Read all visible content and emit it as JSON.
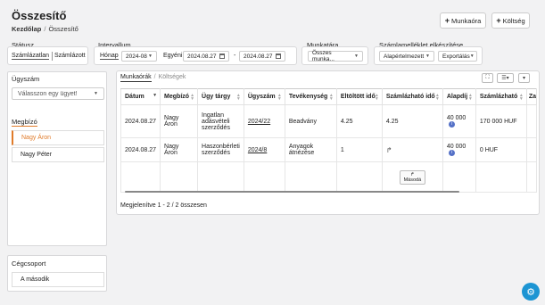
{
  "header": {
    "title": "Összesítő",
    "breadcrumb": {
      "home": "Kezdőlap",
      "separator": "/",
      "current": "Összesítő"
    },
    "add_work_hours": "Munkaóra",
    "add_cost": "Költség"
  },
  "filters": {
    "status": {
      "label": "Státusz",
      "options": [
        "Számlázatlan",
        "Számlázott"
      ],
      "active": "Számlázatlan"
    },
    "interval": {
      "label": "Intervallum",
      "mode_month": "Hónap",
      "month_value": "2024-08",
      "mode_custom": "Egyéni",
      "from": "2024.08.27",
      "dash": "-",
      "to": "2024.08.27"
    },
    "worklist": {
      "label": "Munkatára",
      "value": "Összes munka..."
    },
    "invoice_attachment": {
      "label": "Számlamelléklet elkészítése",
      "template": "Alapértelmezett",
      "export": "Exportálás"
    }
  },
  "sidebar": {
    "case_label": "Ügyszám",
    "case_placeholder": "Válasszon egy ügyet!",
    "client_label": "Megbízó",
    "clients": [
      "Nagy Áron",
      "Nagy Péter"
    ],
    "group_label": "Cégcsoport",
    "group_value": "A második"
  },
  "tabs": {
    "active": "Munkaórák",
    "separator": "/",
    "inactive": "Költségek"
  },
  "table": {
    "columns": [
      "Dátum",
      "Megbízó",
      "Ügy tárgy",
      "Ügyszám",
      "Tevékenység",
      "Eltöltött idő",
      "Számlázható idő",
      "Alapdíj",
      "Számlázható",
      "Za"
    ],
    "rows": [
      {
        "date": "2024.08.27",
        "client": "Nagy Áron",
        "subject": "Ingatlan adásvételi szerződés",
        "case": "2024/22",
        "activity": "Beadvány",
        "spent": "4.25",
        "billable_time": "4.25",
        "base_fee": "40 000",
        "billable": "170 000 HUF"
      },
      {
        "date": "2024.08.27",
        "client": "Nagy Áron",
        "subject": "Haszonbérleti szerződés",
        "case": "2024/8",
        "activity": "Anyagok átnézése",
        "spent": "1",
        "billable_time": "",
        "base_fee": "40 000",
        "billable": "0 HUF"
      }
    ],
    "copy_button": "Másodá",
    "footer": "Megjelenítve 1 - 2 / 2 összesen"
  }
}
